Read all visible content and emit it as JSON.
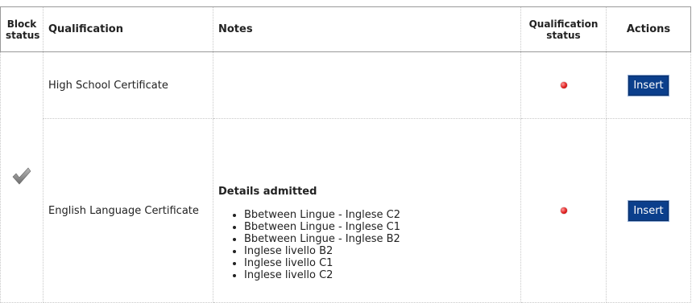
{
  "table": {
    "headers": {
      "block_status": "Block status",
      "qualification": "Qualification",
      "notes": "Notes",
      "qualification_status": "Qualification status",
      "actions": "Actions"
    },
    "rows": [
      {
        "qualification": "High School Certificate",
        "status_icon": "red-dot-icon",
        "action_label": "Insert"
      },
      {
        "qualification": "English Language Certificate",
        "notes_title": "Details admitted",
        "notes_items": [
          "Bbetween Lingue - Inglese C2",
          "Bbetween Lingue - Inglese C1",
          "Bbetween Lingue - Inglese B2",
          "Inglese livello B2",
          "Inglese livello C1",
          "Inglese livello C2"
        ],
        "status_icon": "red-dot-icon",
        "action_label": "Insert"
      }
    ],
    "block_icon": "checkmark-icon"
  },
  "colors": {
    "button_bg": "#0b3f8c",
    "status_dot": "#e02020"
  }
}
